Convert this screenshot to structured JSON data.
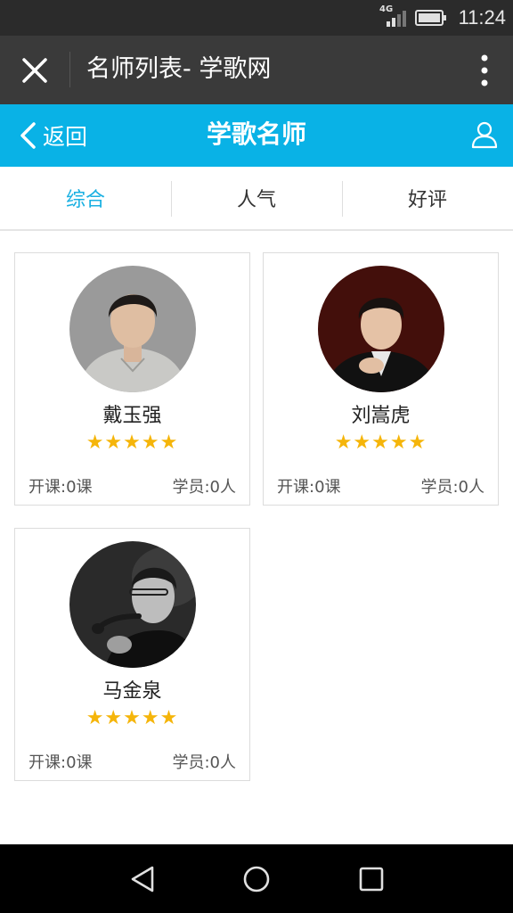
{
  "status_bar": {
    "network": "4G",
    "time": "11:24"
  },
  "title_bar": {
    "title": "名师列表- 学歌网"
  },
  "header": {
    "back_label": "返回",
    "title": "学歌名师"
  },
  "tabs": [
    {
      "label": "综合",
      "active": true
    },
    {
      "label": "人气",
      "active": false
    },
    {
      "label": "好评",
      "active": false
    }
  ],
  "teachers": [
    {
      "name": "戴玉强",
      "stars": "★★★★★",
      "rating": 5,
      "courses": "开课:0课",
      "students": "学员:0人"
    },
    {
      "name": "刘嵩虎",
      "stars": "★★★★★",
      "rating": 5,
      "courses": "开课:0课",
      "students": "学员:0人"
    },
    {
      "name": "马金泉",
      "stars": "★★★★★",
      "rating": 5,
      "courses": "开课:0课",
      "students": "学员:0人"
    }
  ],
  "colors": {
    "accent": "#09b2e6",
    "active_tab": "#1ab0e2",
    "star": "#f5b50a",
    "title_bar": "#3a3a3a"
  },
  "icons": [
    "signal-icon",
    "battery-icon",
    "close-icon",
    "more-vertical-icon",
    "back-chevron-icon",
    "user-icon",
    "nav-back-icon",
    "nav-home-icon",
    "nav-recents-icon"
  ]
}
